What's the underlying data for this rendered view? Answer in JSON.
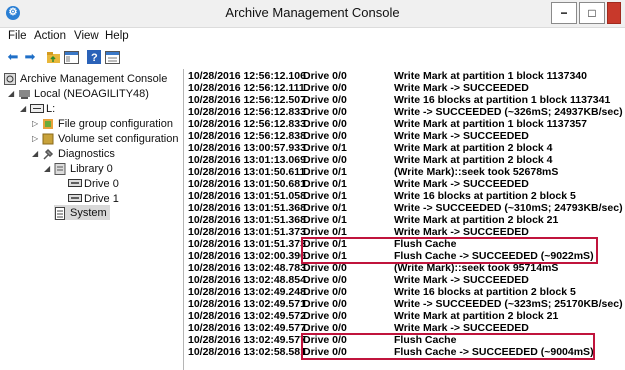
{
  "window": {
    "title": "Archive Management Console",
    "minimize": "−",
    "maximize": "□"
  },
  "menu": [
    "File",
    "Action",
    "View",
    "Help"
  ],
  "toolbar": [
    "back-arrow-icon",
    "forward-arrow-icon",
    "up-folder-icon",
    "show-tree-icon",
    "help-icon",
    "properties-icon"
  ],
  "tree": {
    "root": "Archive Management Console",
    "local": "Local (NEOAGILITY48)",
    "library": "L:",
    "file_group": "File group configuration",
    "volume_set": "Volume set configuration",
    "diagnostics": "Diagnostics",
    "library0": "Library 0",
    "drive0": "Drive 0",
    "drive1": "Drive 1",
    "system": "System"
  },
  "log": [
    [
      "10/28/2016 12:56:12.106",
      "Drive 0/0",
      "Write Mark at partition 1 block 1137340"
    ],
    [
      "10/28/2016 12:56:12.111",
      "Drive 0/0",
      "Write Mark -> SUCCEEDED"
    ],
    [
      "10/28/2016 12:56:12.507",
      "Drive 0/0",
      "Write 16 blocks at partition 1 block 1137341"
    ],
    [
      "10/28/2016 12:56:12.833",
      "Drive 0/0",
      "Write -> SUCCEEDED (~326mS; 24937KB/sec)"
    ],
    [
      "10/28/2016 12:56:12.833",
      "Drive 0/0",
      "Write Mark at partition 1 block 1137357"
    ],
    [
      "10/28/2016 12:56:12.838",
      "Drive 0/0",
      "Write Mark -> SUCCEEDED"
    ],
    [
      "10/28/2016 13:00:57.933",
      "Drive 0/1",
      "Write Mark at partition 2 block 4"
    ],
    [
      "10/28/2016 13:01:13.069",
      "Drive 0/0",
      "Write Mark at partition 2 block 4"
    ],
    [
      "10/28/2016 13:01:50.611",
      "Drive 0/1",
      "(Write Mark)::seek took 52678mS"
    ],
    [
      "10/28/2016 13:01:50.681",
      "Drive 0/1",
      "Write Mark -> SUCCEEDED"
    ],
    [
      "10/28/2016 13:01:51.058",
      "Drive 0/1",
      "Write 16 blocks at partition 2 block 5"
    ],
    [
      "10/28/2016 13:01:51.368",
      "Drive 0/1",
      "Write -> SUCCEEDED (~310mS; 24793KB/sec)"
    ],
    [
      "10/28/2016 13:01:51.368",
      "Drive 0/1",
      "Write Mark at partition 2 block 21"
    ],
    [
      "10/28/2016 13:01:51.373",
      "Drive 0/1",
      "Write Mark -> SUCCEEDED"
    ],
    [
      "10/28/2016 13:01:51.373",
      "Drive 0/1",
      "Flush Cache"
    ],
    [
      "10/28/2016 13:02:00.396",
      "Drive 0/1",
      "Flush Cache -> SUCCEEDED (~9022mS)"
    ],
    [
      "10/28/2016 13:02:48.783",
      "Drive 0/0",
      "(Write Mark)::seek took 95714mS"
    ],
    [
      "10/28/2016 13:02:48.854",
      "Drive 0/0",
      "Write Mark -> SUCCEEDED"
    ],
    [
      "10/28/2016 13:02:49.248",
      "Drive 0/0",
      "Write 16 blocks at partition 2 block 5"
    ],
    [
      "10/28/2016 13:02:49.571",
      "Drive 0/0",
      "Write -> SUCCEEDED (~323mS; 25170KB/sec)"
    ],
    [
      "10/28/2016 13:02:49.572",
      "Drive 0/0",
      "Write Mark at partition 2 block 21"
    ],
    [
      "10/28/2016 13:02:49.577",
      "Drive 0/0",
      "Write Mark -> SUCCEEDED"
    ],
    [
      "10/28/2016 13:02:49.577",
      "Drive 0/0",
      "Flush Cache"
    ],
    [
      "10/28/2016 13:02:58.581",
      "Drive 0/0",
      "Flush Cache -> SUCCEEDED (~9004mS)"
    ]
  ],
  "colors": {
    "highlight": "#c0143c",
    "title_icon": "#2a7fd4",
    "close": "#c8392b"
  }
}
